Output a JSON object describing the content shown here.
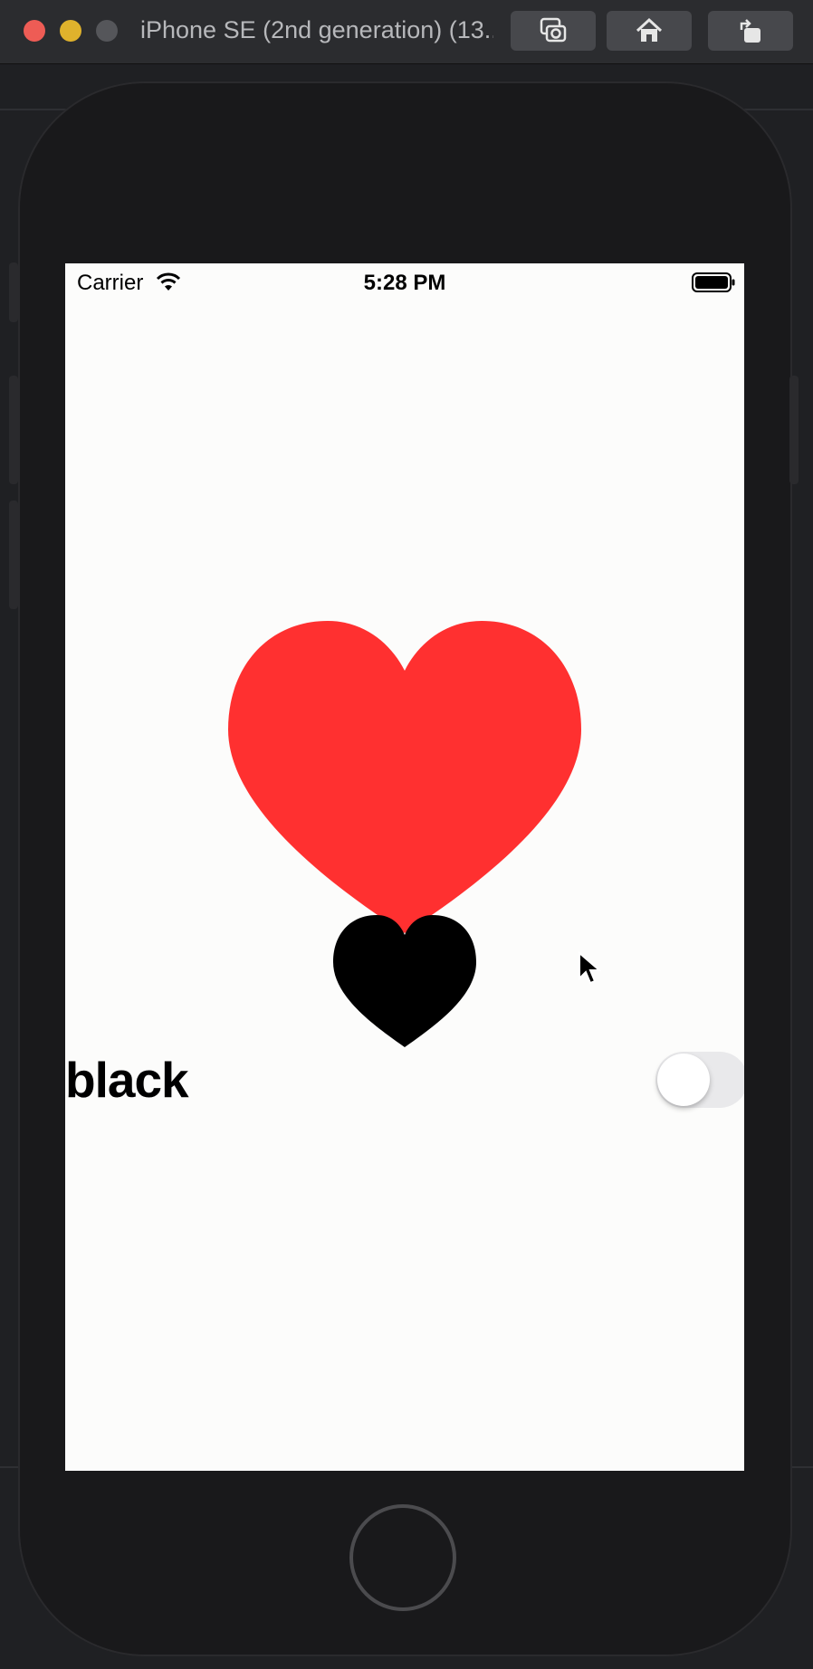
{
  "window": {
    "title": "iPhone SE (2nd generation) (13...",
    "buttons": {
      "screenshot_icon": "camera-icon",
      "home_icon": "home-icon",
      "rotate_icon": "rotate-icon"
    }
  },
  "status_bar": {
    "carrier": "Carrier",
    "time": "5:28 PM"
  },
  "content": {
    "hearts": [
      {
        "name": "large-heart",
        "color": "#ff3030"
      },
      {
        "name": "small-heart",
        "color": "#000000"
      }
    ],
    "toggle": {
      "label": "black",
      "on": false,
      "off_color": "#e9e9eb"
    }
  },
  "colors": {
    "screen_bg": "#fcfcfb",
    "device_bg": "#19191b"
  }
}
